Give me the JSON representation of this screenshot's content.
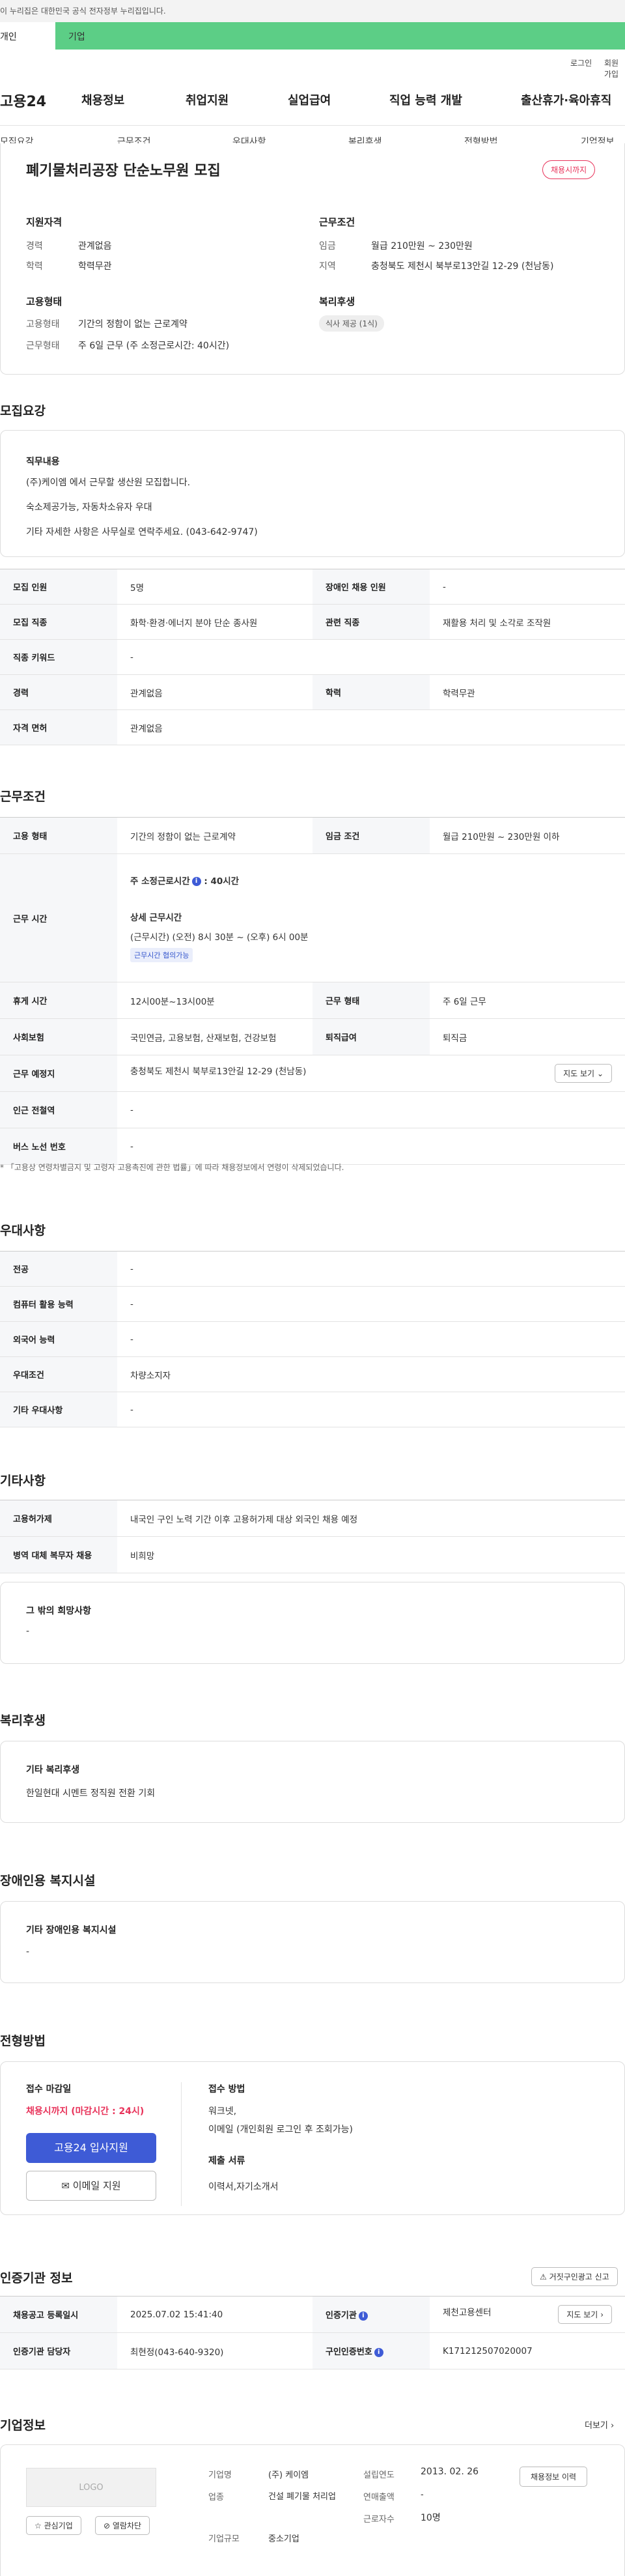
{
  "gov_banner": "이 누리집은 대한민국 공식 전자정부 누리집입니다.",
  "tabs": [
    "개인",
    "기업"
  ],
  "top_links": [
    "로그인",
    "회원가입"
  ],
  "site_logo": "고용24",
  "gnb": [
    "채용정보",
    "취업지원",
    "실업급여",
    "직업 능력 개발",
    "출산휴가·육아휴직"
  ],
  "anchors": [
    "모집요강",
    "근무조건",
    "우대사항",
    "복리후생",
    "전형방법",
    "기업정보"
  ],
  "summary": {
    "title": "폐기물처리공장 단순노무원 모집",
    "status_badge": "채용시까지",
    "qual": {
      "heading": "지원자격",
      "career_label": "경력",
      "career_value": "관계없음",
      "edu_label": "학력",
      "edu_value": "학력무관"
    },
    "cond": {
      "heading": "근무조건",
      "wage_label": "임금",
      "wage_value": "월급 210만원 ~ 230만원",
      "loc_label": "지역",
      "loc_value": "충청북도 제천시 북부로13안길 12-29 (천남동)"
    },
    "emp": {
      "heading": "고용형태",
      "type_label": "고용형태",
      "type_value": "기간의 정함이 없는 근로계약",
      "form_label": "근무형태",
      "form_value": "주 6일 근무 (주 소정근로시간: 40시간)"
    },
    "welfare": {
      "heading": "복리후생",
      "tag": "식사 제공 (1식)"
    }
  },
  "recruit": {
    "heading": "모집요강",
    "job_title": "직무내용",
    "job_lines": [
      "(주)케이엠 에서 근무할 생산원 모집합니다.",
      "숙소제공가능, 자동차소유자 우대",
      "기타 자세한 사항은 사무실로 연락주세요. (043-642-9747)"
    ],
    "rows": [
      {
        "k1": "모집 인원",
        "v1": "5명",
        "k2": "장애인 채용 인원",
        "v2": "-"
      },
      {
        "k1": "모집 직종",
        "v1": "화학·환경·에너지 분야 단순 종사원",
        "k2": "관련 직종",
        "v2": "재활용 처리 및 소각로 조작원"
      },
      {
        "k1": "직종 키워드",
        "v1": "-",
        "k2": "",
        "v2": ""
      },
      {
        "k1": "경력",
        "v1": "관계없음",
        "k2": "학력",
        "v2": "학력무관"
      },
      {
        "k1": "자격 면허",
        "v1": "관계없음",
        "k2": "",
        "v2": ""
      }
    ]
  },
  "work": {
    "heading": "근무조건",
    "row1": {
      "k1": "고용 형태",
      "v1": "기간의 정함이 없는 근로계약",
      "k2": "임금 조건",
      "v2": "월급 210만원 ~ 230만원 이하"
    },
    "hours_label": "근무 시간",
    "hours_main_label": "주 소정근로시간",
    "hours_main_value": "40시간",
    "hours_detail_title": "상세 근무시간",
    "hours_detail_value": "(근무시간) (오전) 8시 30분 ~ (오후) 6시 00분",
    "hours_tag": "근무시간 협의가능",
    "row3": {
      "k1": "휴게 시간",
      "v1": "12시00분~13시00분",
      "k2": "근무 형태",
      "v2": "주 6일 근무"
    },
    "row4": {
      "k1": "사회보험",
      "v1": "국민연금, 고용보험, 산재보험, 건강보험",
      "k2": "퇴직급여",
      "v2": "퇴직금"
    },
    "loc_label": "근무 예정지",
    "loc_value": "충청북도 제천시 북부로13안길 12-29 (천남동)",
    "map_btn": "지도 보기",
    "station_label": "인근 전철역",
    "station_value": "-",
    "bus_label": "버스 노선 번호",
    "bus_value": "-",
    "note": "* 「고용상 연령차별금지 및 고령자 고용촉진에 관한 법률」에 따라 채용정보에서 연령이 삭제되었습니다."
  },
  "pref": {
    "heading": "우대사항",
    "rows": [
      {
        "k": "전공",
        "v": "-"
      },
      {
        "k": "컴퓨터 활용 능력",
        "v": "-"
      },
      {
        "k": "외국어 능력",
        "v": "-"
      },
      {
        "k": "우대조건",
        "v": "차량소지자"
      },
      {
        "k": "기타 우대사항",
        "v": "-"
      }
    ]
  },
  "etc": {
    "heading": "기타사항",
    "rows": [
      {
        "k": "고용허가제",
        "v": "내국인 구인 노력 기간 이후 고용허가제 대상 외국인 채용 예정"
      },
      {
        "k": "병역 대체 복무자 채용",
        "v": "비희망"
      }
    ],
    "other_title": "그 밖의 희망사항",
    "other_value": "-"
  },
  "benefit": {
    "heading": "복리후생",
    "title": "기타 복리후생",
    "value": "한일현대 시멘트 정직원 전환 기회"
  },
  "disabled": {
    "heading": "장애인용 복지시설",
    "title": "기타 장애인용 복지시설",
    "value": "-"
  },
  "selection": {
    "heading": "전형방법",
    "deadline_title": "접수 마감일",
    "deadline_value": "채용시까지 (마감시간 : 24시)",
    "apply_btn": "고용24 입사지원",
    "email_btn": "이메일 지원",
    "method_title": "접수 방법",
    "method_value": "워크넷,",
    "method_value2": "이메일 (개인회원 로그인 후 조회가능)",
    "docs_title": "제출 서류",
    "docs_value": "이력서,자기소개서"
  },
  "agency": {
    "heading": "인증기관 정보",
    "report_btn": "거짓구인광고 신고",
    "r1": {
      "k1": "채용공고 등록일시",
      "v1": "2025.07.02 15:41:40",
      "k2": "인증기관",
      "v2": "제천고용센터",
      "btn": "지도 보기"
    },
    "r2": {
      "k1": "인증기관 담당자",
      "v1": "최현정(043-640-9320)",
      "k2": "구인인증번호",
      "v2": "K171212507020007"
    }
  },
  "company": {
    "heading": "기업정보",
    "more": "더보기",
    "logo": "LOGO",
    "fav_btn": "관심기업",
    "block_btn": "열람차단",
    "name_label": "기업명",
    "name_value": "(주) 케이엠",
    "ind_label": "업종",
    "ind_value": "건설 폐기물 처리업",
    "size_label": "기업규모",
    "size_value": "중소기업",
    "year_label": "설립연도",
    "year_value": "2013. 02. 26",
    "sales_label": "연매출액",
    "sales_value": "-",
    "emp_label": "근로자수",
    "emp_value": "10명",
    "history_btn": "채용정보 이력"
  }
}
